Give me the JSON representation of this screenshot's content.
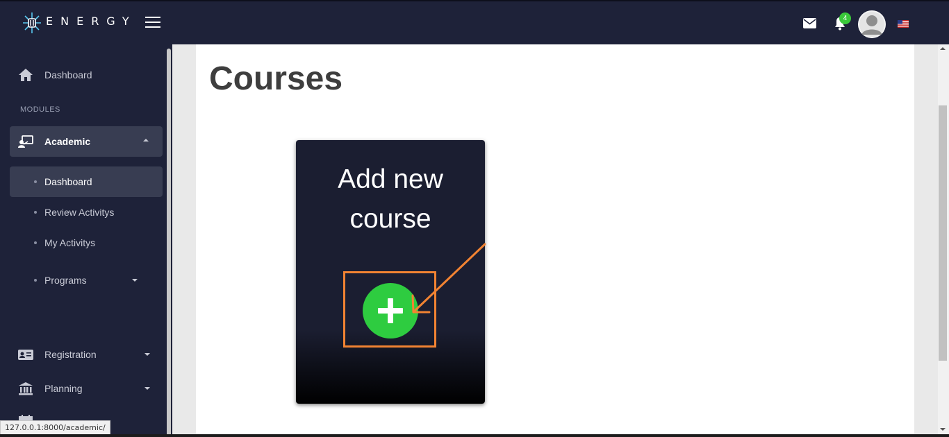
{
  "header": {
    "brand": "ENERGY",
    "notification_count": "4",
    "icons": [
      "energy-logo-icon",
      "hamburger-icon",
      "mail-icon",
      "bell-icon",
      "avatar",
      "us-flag-icon"
    ]
  },
  "sidebar": {
    "section_label": "MODULES",
    "items": [
      {
        "label": "Dashboard",
        "icon": "home-icon"
      },
      {
        "label": "Academic",
        "icon": "teacher-board-icon",
        "expanded": true
      },
      {
        "label": "Dashboard",
        "active": true
      },
      {
        "label": "Review Activitys"
      },
      {
        "label": "My Activitys"
      },
      {
        "label": "Programs"
      },
      {
        "label": "Registration",
        "icon": "id-card-icon"
      },
      {
        "label": "Planning",
        "icon": "bank-icon"
      }
    ]
  },
  "main": {
    "title": "Courses",
    "card": {
      "title_line1": "Add new",
      "title_line2": "course",
      "button_icon": "plus-icon"
    }
  },
  "colors": {
    "navbar": "#1e2239",
    "sidebar_active": "#383d52",
    "add_button": "#2ecc40",
    "annotation": "#f28332",
    "badge": "#3ac93a"
  },
  "status_bar": {
    "url": "127.0.0.1:8000/academic/"
  }
}
